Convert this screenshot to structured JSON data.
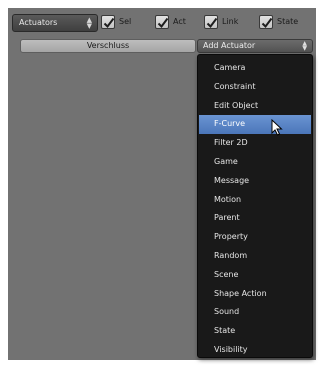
{
  "header": {
    "sensor_dropdown": {
      "label": "Actuators",
      "icon": "up-down-arrows-icon"
    },
    "options": [
      {
        "label": "Sel",
        "checked": true
      },
      {
        "label": "Act",
        "checked": true
      },
      {
        "label": "Link",
        "checked": true
      },
      {
        "label": "State",
        "checked": true
      }
    ]
  },
  "actuator": {
    "name": "Verschluss",
    "add_dropdown": {
      "label": "Add Actuator",
      "icon": "up-down-arrows-icon"
    }
  },
  "menu": {
    "items": [
      "Camera",
      "Constraint",
      "Edit Object",
      "F-Curve",
      "Filter 2D",
      "Game",
      "Message",
      "Motion",
      "Parent",
      "Property",
      "Random",
      "Scene",
      "Shape Action",
      "Sound",
      "State",
      "Visibility"
    ],
    "highlighted": "F-Curve"
  },
  "colors": {
    "panel_bg": "#727272",
    "menu_bg": "#191919",
    "highlight": "#5a85c6",
    "checkmark": "#1e1e1e"
  }
}
